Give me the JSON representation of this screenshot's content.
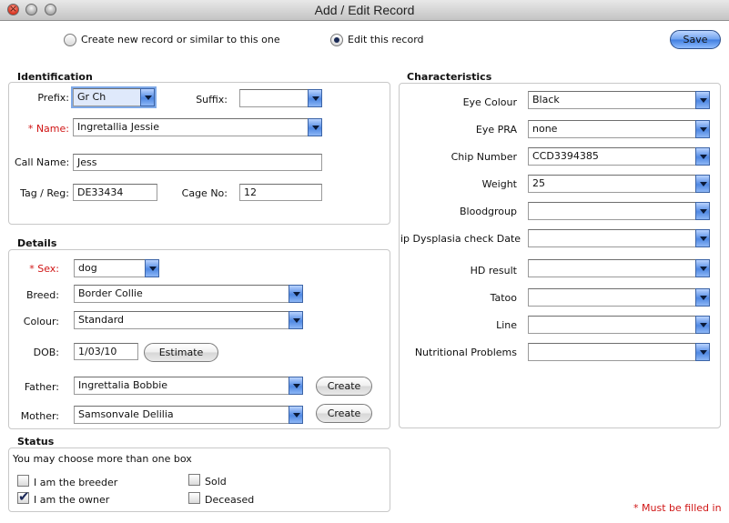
{
  "window": {
    "title": "Add / Edit Record"
  },
  "mode": {
    "create_label": "Create new record or similar to this one",
    "edit_label": "Edit this record",
    "save_label": "Save"
  },
  "identification": {
    "title": "Identification",
    "prefix_label": "Prefix:",
    "prefix_value": "Gr Ch",
    "suffix_label": "Suffix:",
    "suffix_value": "",
    "name_required": "* ",
    "name_label": "Name:",
    "name_value": "Ingretallia Jessie",
    "callname_label": "Call Name:",
    "callname_value": "Jess",
    "tag_label": "Tag / Reg:",
    "tag_value": "DE33434",
    "cage_label": "Cage No:",
    "cage_value": "12"
  },
  "details": {
    "title": "Details",
    "sex_required": "* ",
    "sex_label": "Sex:",
    "sex_value": "dog",
    "breed_label": "Breed:",
    "breed_value": "Border Collie",
    "colour_label": "Colour:",
    "colour_value": "Standard",
    "dob_label": "DOB:",
    "dob_value": "1/03/10",
    "estimate_label": "Estimate",
    "father_label": "Father:",
    "father_value": "Ingrettalia Bobbie",
    "mother_label": "Mother:",
    "mother_value": "Samsonvale Delilia",
    "create_label": "Create"
  },
  "status": {
    "title": "Status",
    "hint": "You may choose more than one box",
    "breeder_label": "I am the breeder",
    "owner_label": "I am the owner",
    "sold_label": "Sold",
    "deceased_label": "Deceased",
    "breeder_checked": false,
    "owner_checked": true,
    "sold_checked": false,
    "deceased_checked": false
  },
  "characteristics": {
    "title": "Characteristics",
    "rows": [
      {
        "label": "Eye Colour",
        "value": "Black"
      },
      {
        "label": "Eye PRA",
        "value": "none"
      },
      {
        "label": "Chip Number",
        "value": "CCD3394385"
      },
      {
        "label": "Weight",
        "value": "25"
      },
      {
        "label": "Bloodgroup",
        "value": ""
      },
      {
        "label": "ip Dysplasia check Date",
        "value": ""
      },
      {
        "label": "HD result",
        "value": ""
      },
      {
        "label": "Tatoo",
        "value": ""
      },
      {
        "label": "Line",
        "value": ""
      },
      {
        "label": "Nutritional Problems",
        "value": ""
      }
    ]
  },
  "footer": {
    "required_note": "* Must be filled in"
  },
  "colors": {
    "required": "#d01515",
    "accent": "#3f7ddf"
  }
}
